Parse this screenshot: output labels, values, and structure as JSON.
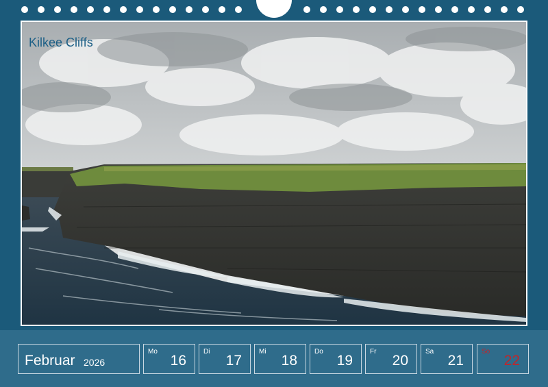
{
  "photo": {
    "caption": "Kilkee Cliffs"
  },
  "calendar": {
    "month": "Februar",
    "year": "2026",
    "days": [
      {
        "name": "Mo",
        "num": "16"
      },
      {
        "name": "Di",
        "num": "17"
      },
      {
        "name": "Mi",
        "num": "18"
      },
      {
        "name": "Do",
        "num": "19"
      },
      {
        "name": "Fr",
        "num": "20"
      },
      {
        "name": "Sa",
        "num": "21"
      },
      {
        "name": "So",
        "num": "22"
      }
    ]
  },
  "colors": {
    "frame": "#1b5a7a",
    "footer": "#2f6c8b",
    "caption": "#1c5f86",
    "sunday": "#c0262b"
  }
}
